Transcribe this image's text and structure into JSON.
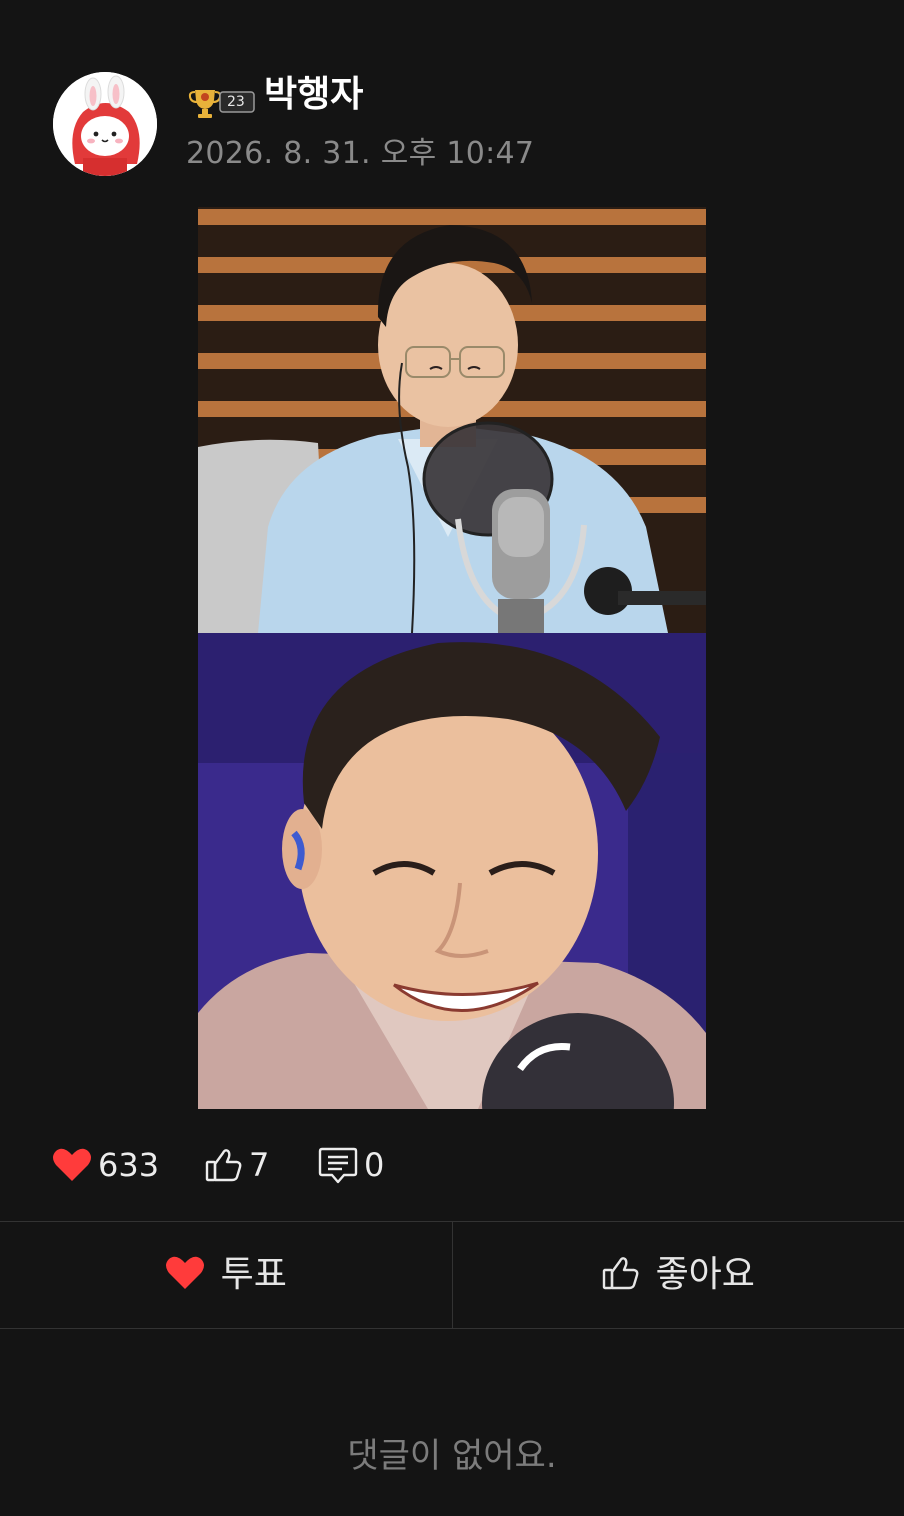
{
  "post": {
    "author": {
      "name": "박행자",
      "badge_level": "23",
      "badge_icon": "trophy-icon",
      "avatar_icon": "bunny-avatar"
    },
    "timestamp": "2026. 8. 31. 오후 10:47",
    "images": [
      {
        "icon": "photo-radio-host-microphone"
      },
      {
        "icon": "photo-smiling-man-closeup"
      }
    ]
  },
  "stats": {
    "votes": "633",
    "likes": "7",
    "comments": "0",
    "vote_icon": "heart-icon",
    "like_icon": "thumbs-up-icon",
    "comment_icon": "comment-icon"
  },
  "actions": {
    "vote_label": "투표",
    "like_label": "좋아요"
  },
  "comments": {
    "empty_text": "댓글이 없어요."
  },
  "colors": {
    "background": "#141414",
    "heart": "#ff3b3b",
    "muted_text": "#8a8a8a",
    "divider": "#333333"
  }
}
